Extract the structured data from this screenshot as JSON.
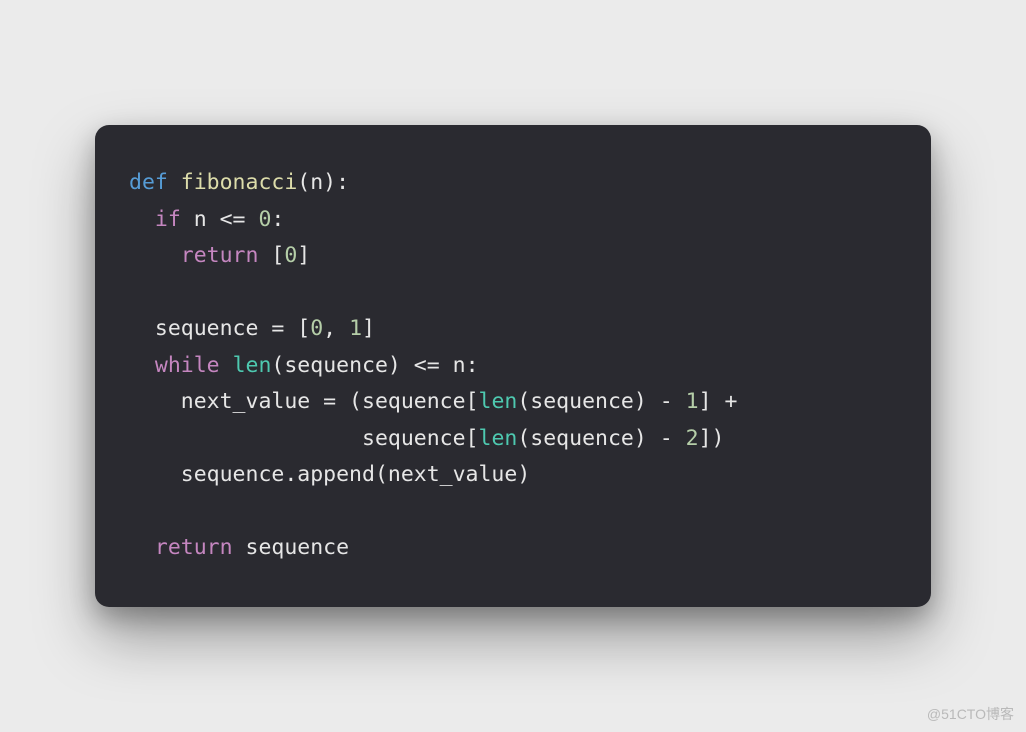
{
  "watermark": "@51CTO博客",
  "code": {
    "lines": [
      [
        {
          "cls": "tok-def",
          "t": "def "
        },
        {
          "cls": "tok-func",
          "t": "fibonacci"
        },
        {
          "cls": "tok-default",
          "t": "(n):"
        }
      ],
      [
        {
          "cls": "tok-default",
          "t": "  "
        },
        {
          "cls": "tok-keyword",
          "t": "if"
        },
        {
          "cls": "tok-default",
          "t": " n <= "
        },
        {
          "cls": "tok-number",
          "t": "0"
        },
        {
          "cls": "tok-default",
          "t": ":"
        }
      ],
      [
        {
          "cls": "tok-default",
          "t": "    "
        },
        {
          "cls": "tok-keyword",
          "t": "return"
        },
        {
          "cls": "tok-default",
          "t": " ["
        },
        {
          "cls": "tok-number",
          "t": "0"
        },
        {
          "cls": "tok-default",
          "t": "]"
        }
      ],
      [
        {
          "cls": "tok-default",
          "t": ""
        }
      ],
      [
        {
          "cls": "tok-default",
          "t": "  sequence = ["
        },
        {
          "cls": "tok-number",
          "t": "0"
        },
        {
          "cls": "tok-default",
          "t": ", "
        },
        {
          "cls": "tok-number",
          "t": "1"
        },
        {
          "cls": "tok-default",
          "t": "]"
        }
      ],
      [
        {
          "cls": "tok-default",
          "t": "  "
        },
        {
          "cls": "tok-keyword",
          "t": "while"
        },
        {
          "cls": "tok-default",
          "t": " "
        },
        {
          "cls": "tok-builtin",
          "t": "len"
        },
        {
          "cls": "tok-default",
          "t": "(sequence) <= n:"
        }
      ],
      [
        {
          "cls": "tok-default",
          "t": "    next_value = (sequence["
        },
        {
          "cls": "tok-builtin",
          "t": "len"
        },
        {
          "cls": "tok-default",
          "t": "(sequence) - "
        },
        {
          "cls": "tok-number",
          "t": "1"
        },
        {
          "cls": "tok-default",
          "t": "] +"
        }
      ],
      [
        {
          "cls": "tok-default",
          "t": "                  sequence["
        },
        {
          "cls": "tok-builtin",
          "t": "len"
        },
        {
          "cls": "tok-default",
          "t": "(sequence) - "
        },
        {
          "cls": "tok-number",
          "t": "2"
        },
        {
          "cls": "tok-default",
          "t": "])"
        }
      ],
      [
        {
          "cls": "tok-default",
          "t": "    sequence.append(next_value)"
        }
      ],
      [
        {
          "cls": "tok-default",
          "t": ""
        }
      ],
      [
        {
          "cls": "tok-default",
          "t": "  "
        },
        {
          "cls": "tok-keyword",
          "t": "return"
        },
        {
          "cls": "tok-default",
          "t": " sequence"
        }
      ]
    ]
  }
}
